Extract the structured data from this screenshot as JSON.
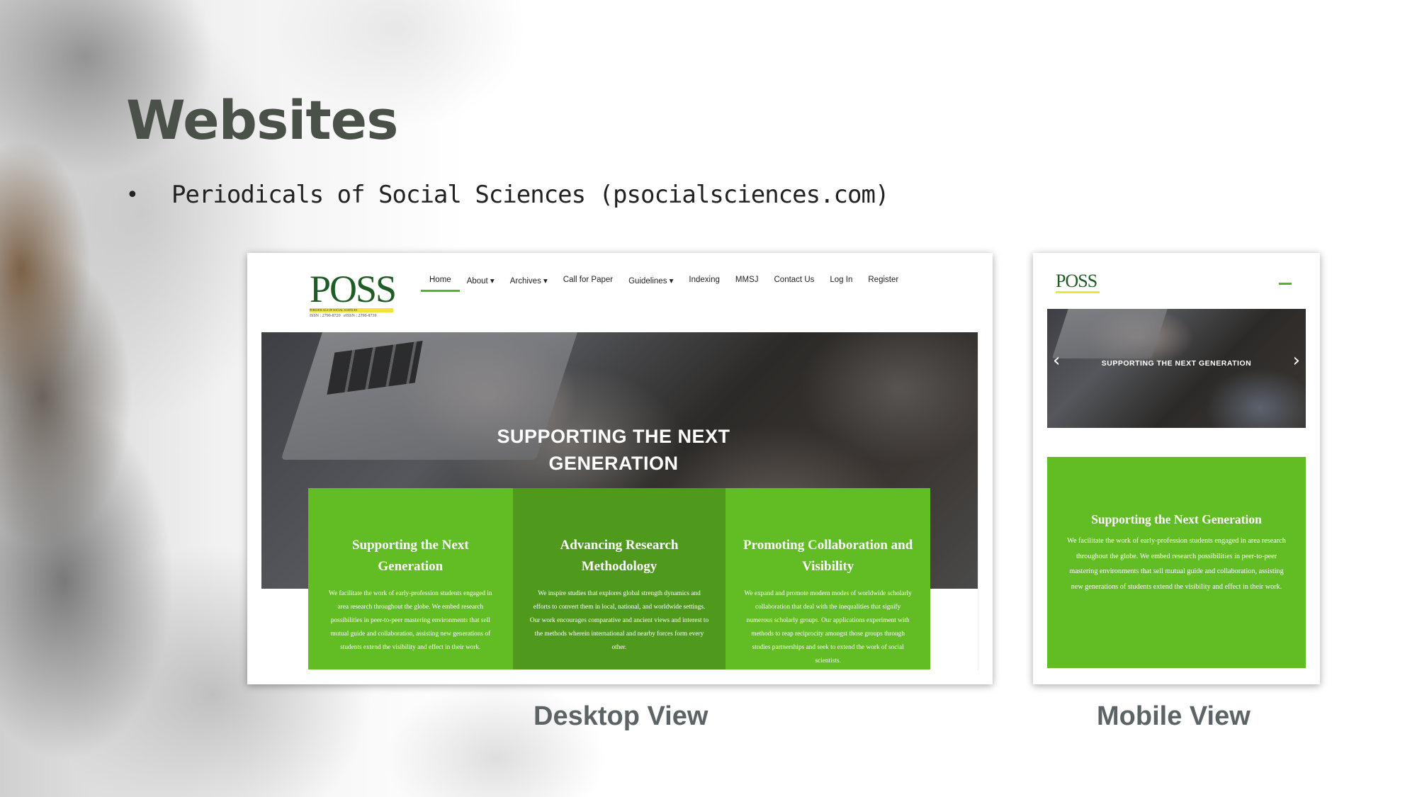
{
  "slide": {
    "title": "Websites",
    "bullet": "Periodicals of Social Sciences (psocialsciences.com)",
    "bullet_glyph": "•"
  },
  "site": {
    "logo_text": "POSS",
    "logo_subtitle": "PERIODICALS OF SOCIAL SCIENCES",
    "issn": "ISSN : 2790-8720",
    "eissn": "eISSN : 2790-8739",
    "accent_color": "#62bc24",
    "nav": [
      {
        "label": "Home",
        "active": true
      },
      {
        "label": "About ▾"
      },
      {
        "label": "Archives ▾"
      },
      {
        "label": "Call for Paper"
      },
      {
        "label": "Guidelines ▾"
      },
      {
        "label": "Indexing"
      },
      {
        "label": "MMSJ"
      },
      {
        "label": "Contact Us"
      },
      {
        "label": "Log In"
      },
      {
        "label": "Register"
      }
    ],
    "hero_title": "SUPPORTING THE NEXT GENERATION",
    "cards": [
      {
        "title": "Supporting the Next Generation",
        "text": "We facilitate the work of early-profession students engaged in area research throughout the globe. We embed research possibilities in peer-to-peer mastering environments that sell mutual guide and collaboration, assisting new generations of students extend the visibility and effect in their work."
      },
      {
        "title": "Advancing Research Methodology",
        "text": "We inspire studies that explores global strength dynamics and efforts to convert them in local, national, and worldwide settings. Our work encourages comparative and ancient views and interest to the methods wherein international and nearby forces form every other."
      },
      {
        "title": "Promoting Collaboration and Visibility",
        "text": "We expand and promote modern modes of worldwide scholarly collaboration that deal with the inequalities that signify numerous scholarly groups. Our applications experiment with methods to reap reciprocity amongst those groups through studies partnerships and seek to extend the work of social scientists."
      }
    ]
  },
  "mobile": {
    "hero_title": "SUPPORTING THE NEXT GENERATION",
    "arrow_left": "‹",
    "arrow_right": "›",
    "card_title": "Supporting the Next Generation",
    "card_text": "We facilitate the work of early-profession students engaged in area research throughout the globe. We embed research possibilities in peer-to-peer mastering environments that sell mutual guide and collaboration, assisting new generations of students extend the visibility and effect in their work."
  },
  "captions": {
    "desktop": "Desktop View",
    "mobile": "Mobile View"
  }
}
